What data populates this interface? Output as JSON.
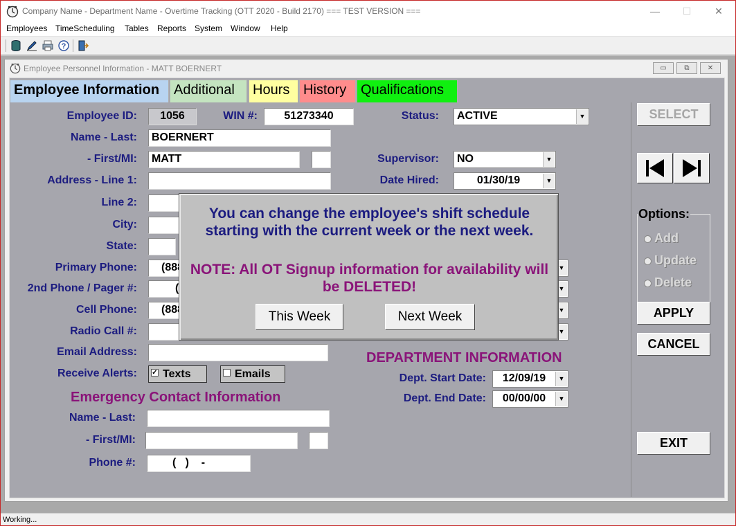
{
  "app": {
    "title": "Company Name - Department Name - Overtime Tracking (OTT 2020 - Build 2170) === TEST VERSION ===",
    "window_controls": {
      "minimize": "—",
      "maximize": "☐",
      "close": "✕"
    }
  },
  "menu": {
    "items": [
      {
        "label": "Employees"
      },
      {
        "label": "TimeScheduling"
      },
      {
        "label": "Tables"
      },
      {
        "label": "Reports"
      },
      {
        "label": "System"
      },
      {
        "label": "Window"
      },
      {
        "label": "Help"
      }
    ]
  },
  "toolbar": {
    "icons": [
      "database-icon",
      "edit-pencil-icon",
      "printer-icon",
      "help-icon",
      "exit-door-icon"
    ]
  },
  "child": {
    "title": "Employee Personnel Information - MATT BOERNERT",
    "controls": {
      "minimize": "▭",
      "restore": "⧉",
      "close": "✕"
    }
  },
  "tabs": [
    {
      "label": "Employee Information",
      "color": "#b8d4f0",
      "active": true
    },
    {
      "label": "Additional",
      "color": "#c4e4c0",
      "active": false
    },
    {
      "label": "Hours",
      "color": "#ffffa0",
      "active": false
    },
    {
      "label": "History",
      "color": "#ff8c8c",
      "active": false
    },
    {
      "label": "Qualifications",
      "color": "#10f010",
      "active": false
    }
  ],
  "form": {
    "employee_id": {
      "label": "Employee ID:",
      "value": "1056"
    },
    "win": {
      "label": "WIN #:",
      "value": "51273340"
    },
    "status": {
      "label": "Status:",
      "value": "ACTIVE"
    },
    "name_last": {
      "label": "Name - Last:",
      "value": "BOERNERT"
    },
    "first_mi": {
      "label": "- First/MI:",
      "value": "MATT",
      "mi": ""
    },
    "supervisor": {
      "label": "Supervisor:",
      "value": "NO"
    },
    "address1": {
      "label": "Address - Line 1:",
      "value": ""
    },
    "date_hired": {
      "label": "Date Hired:",
      "value": "01/30/19"
    },
    "line2": {
      "label": "Line 2:",
      "value": ""
    },
    "city": {
      "label": "City:",
      "value": ""
    },
    "state": {
      "label": "State:",
      "value": ""
    },
    "primary_phone": {
      "label": "Primary Phone:",
      "value": "(888"
    },
    "phone2": {
      "label": "2nd Phone / Pager #:",
      "value": "("
    },
    "cell_phone": {
      "label": "Cell Phone:",
      "value": "(888"
    },
    "radio_call": {
      "label": "Radio Call #:",
      "value": ""
    },
    "email": {
      "label": "Email Address:",
      "value": ""
    },
    "receive_alerts": {
      "label": "Receive Alerts:",
      "texts": "Texts",
      "emails": "Emails",
      "texts_checked": true,
      "emails_checked": false
    }
  },
  "emergency": {
    "heading": "Emergency Contact Information",
    "name_last": {
      "label": "Name - Last:",
      "value": ""
    },
    "first_mi": {
      "label": "- First/MI:",
      "value": "",
      "mi": ""
    },
    "phone": {
      "label": "Phone #:",
      "value": "(   )    -"
    }
  },
  "department": {
    "heading": "DEPARTMENT INFORMATION",
    "start": {
      "label": "Dept. Start Date:",
      "value": "12/09/19"
    },
    "end": {
      "label": "Dept. End Date:",
      "value": "00/00/00"
    }
  },
  "side": {
    "select": "SELECT",
    "options_label": "Options:",
    "options": [
      "Add",
      "Update",
      "Delete"
    ],
    "apply": "APPLY",
    "cancel": "CANCEL",
    "exit": "EXIT"
  },
  "dialog": {
    "message": "You can change the employee's shift schedule starting with the current week or the next week.",
    "note": "NOTE:  All OT Signup information for availability will be DELETED!",
    "this_week": "This Week",
    "next_week": "Next Week"
  },
  "status_bar": {
    "text": "Working..."
  }
}
